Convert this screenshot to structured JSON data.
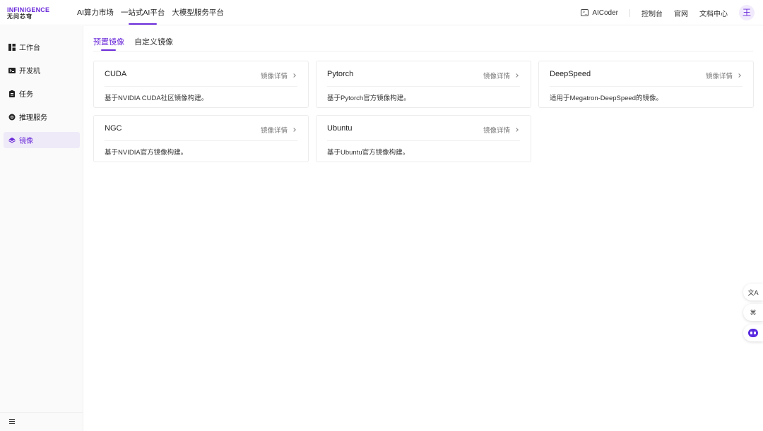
{
  "brand": {
    "line1": "INFINIGENCE",
    "line2": "无问芯穹",
    "accent": "#6b2bd9"
  },
  "topnav": {
    "items": [
      {
        "label": "AI算力市场",
        "active": false
      },
      {
        "label": "一站式AI平台",
        "active": true
      },
      {
        "label": "大模型服务平台",
        "active": false
      }
    ],
    "aicoder": "AICoder",
    "links": [
      "控制台",
      "官网",
      "文档中心"
    ],
    "avatar": "王"
  },
  "sidebar": {
    "items": [
      {
        "label": "工作台",
        "icon": "dashboard-icon",
        "active": false
      },
      {
        "label": "开发机",
        "icon": "terminal-icon",
        "active": false
      },
      {
        "label": "任务",
        "icon": "clipboard-icon",
        "active": false
      },
      {
        "label": "推理服务",
        "icon": "inference-icon",
        "active": false
      },
      {
        "label": "镜像",
        "icon": "layers-icon",
        "active": true
      }
    ],
    "collapse_icon": "menu-icon"
  },
  "tabs": [
    {
      "label": "预置镜像",
      "active": true
    },
    {
      "label": "自定义镜像",
      "active": false
    }
  ],
  "cards": [
    {
      "title": "CUDA",
      "link": "镜像详情",
      "desc": "基于NVIDIA CUDA社区镜像构建。"
    },
    {
      "title": "Pytorch",
      "link": "镜像详情",
      "desc": "基于Pytorch官方镜像构建。"
    },
    {
      "title": "DeepSpeed",
      "link": "镜像详情",
      "desc": "适用于Megatron-DeepSpeed的镜像。"
    },
    {
      "title": "NGC",
      "link": "镜像详情",
      "desc": "基于NVIDIA官方镜像构建。"
    },
    {
      "title": "Ubuntu",
      "link": "镜像详情",
      "desc": "基于Ubuntu官方镜像构建。"
    }
  ],
  "float_buttons": [
    {
      "icon": "translate-icon",
      "glyph": "文A"
    },
    {
      "icon": "command-icon",
      "glyph": "⌘"
    },
    {
      "icon": "assistant-bot-icon",
      "glyph": ""
    }
  ]
}
